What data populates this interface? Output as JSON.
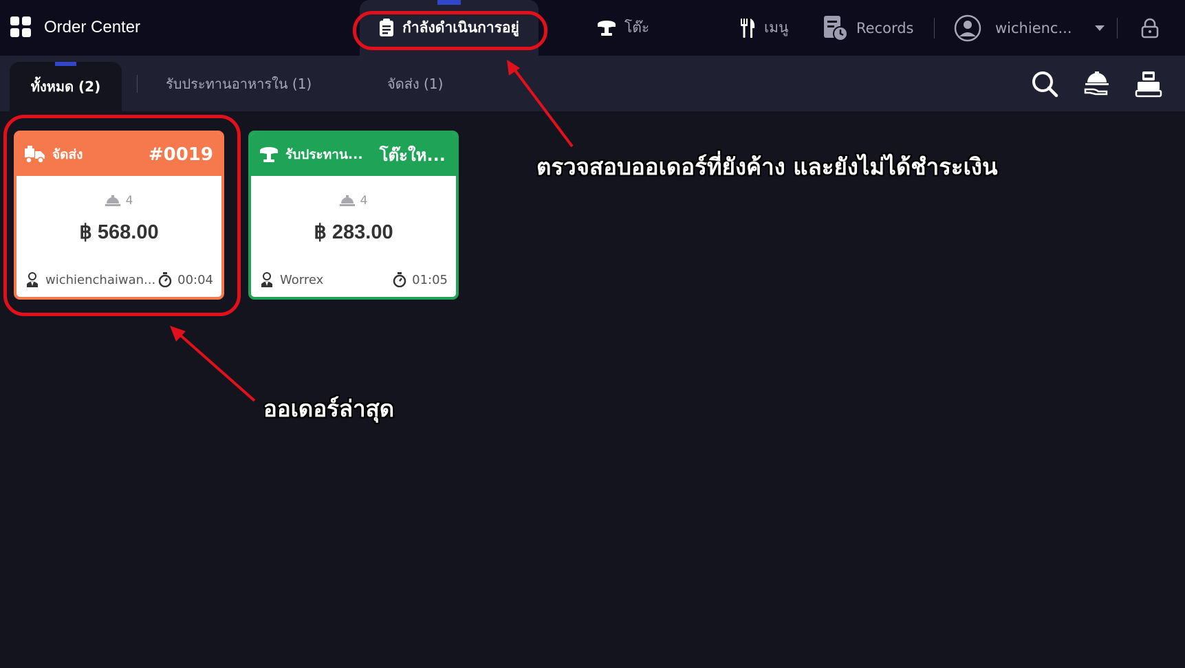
{
  "app": {
    "title": "Order Center"
  },
  "nav": {
    "in_progress": "กำลังดำเนินการอยู่",
    "tables": "โต๊ะ",
    "menu": "เมนู",
    "records": "Records",
    "username": "wichienc..."
  },
  "tabs": [
    {
      "label": "ทั้งหมด (2)"
    },
    {
      "label": "รับประทานอาหารใน (1)"
    },
    {
      "label": "จัดส่ง (1)"
    }
  ],
  "orders": [
    {
      "type": "จัดส่ง",
      "number": "#0019",
      "items": "4",
      "amount": "฿ 568.00",
      "staff": "wichienchaiwan...",
      "elapsed": "00:04",
      "color": "#f5794d"
    },
    {
      "type": "รับประทาน...",
      "number": "โต๊ะให...",
      "items": "4",
      "amount": "฿ 283.00",
      "staff": "Worrex",
      "elapsed": "01:05",
      "color": "#1fa356"
    }
  ],
  "annotations": {
    "pending_orders": "ตรวจสอบออเดอร์ที่ยังค้าง และยังไม่ได้ชำระเงิน",
    "latest_order": "ออเดอร์ล่าสุด",
    "highlight_color": "#e2101a"
  }
}
